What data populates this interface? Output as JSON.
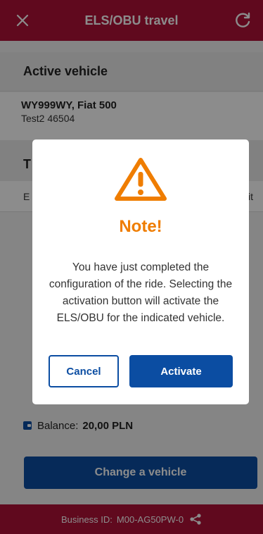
{
  "header": {
    "title": "ELS/OBU travel",
    "close_icon": "close-icon",
    "refresh_icon": "refresh-icon"
  },
  "active_vehicle": {
    "heading": "Active vehicle",
    "plate": "WY999WY, Fiat 500",
    "sub": "Test2 46504"
  },
  "travel": {
    "heading_partial": "T",
    "row_left": "E",
    "row_right": "it"
  },
  "balance": {
    "label": "Balance:",
    "amount": "20,00 PLN"
  },
  "change_vehicle_label": "Change a vehicle",
  "footer": {
    "label": "Business ID:",
    "value": "M00-AG50PW-0"
  },
  "dialog": {
    "heading": "Note!",
    "message": "You have just completed the configuration of the ride. Selecting the activation button will activate the ELS/OBU for the indicated vehicle.",
    "cancel_label": "Cancel",
    "activate_label": "Activate"
  },
  "colors": {
    "brand_red": "#b01238",
    "primary_blue": "#0b4da2",
    "warning_orange": "#ef7d00"
  }
}
